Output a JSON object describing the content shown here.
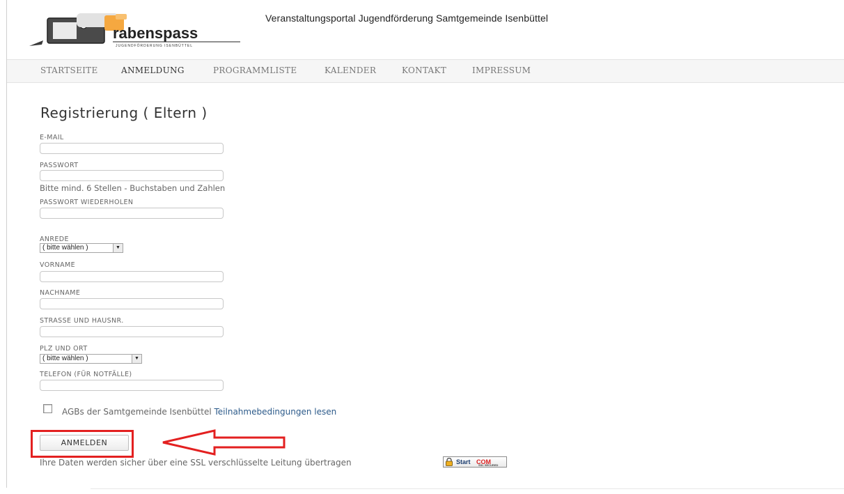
{
  "header": {
    "logo_text": "rabenspass",
    "logo_subtitle": "JUGENDFÖRDERUNG ISENBÜTTEL",
    "site_title": "Veranstaltungsportal Jugendförderung Samtgemeinde Isenbüttel"
  },
  "nav": {
    "items": [
      "STARTSEITE",
      "ANMELDUNG",
      "PROGRAMMLISTE",
      "KALENDER",
      "KONTAKT",
      "IMPRESSUM"
    ],
    "active": "ANMELDUNG"
  },
  "form": {
    "title": "Registrierung ( Eltern )",
    "email_label": "E-MAIL",
    "password_label": "PASSWORT",
    "password_hint": "Bitte mind. 6 Stellen - Buchstaben und Zahlen",
    "password_repeat_label": "PASSWORT WIEDERHOLEN",
    "salutation_label": "ANREDE",
    "salutation_value": "( bitte wählen )",
    "firstname_label": "VORNAME",
    "lastname_label": "NACHNAME",
    "street_label": "STRASSE UND HAUSNR.",
    "zip_city_label": "PLZ UND ORT",
    "zip_city_value": "( bitte wählen )",
    "phone_label": "TELEFON (FÜR NOTFÄLLE)",
    "agb_text": "AGBs der Samtgemeinde Isenbüttel",
    "agb_link": "Teilnahmebedingungen lesen",
    "submit_label": "ANMELDEN",
    "ssl_text": "Ihre Daten werden sicher über eine SSL verschlüsselte Leitung übertragen"
  },
  "ssl_badge": {
    "text_start": "Start",
    "text_com": "COM",
    "text_secured": "SSL SECURED"
  },
  "colors": {
    "highlight": "#e32020",
    "link": "#2c5a8a"
  }
}
